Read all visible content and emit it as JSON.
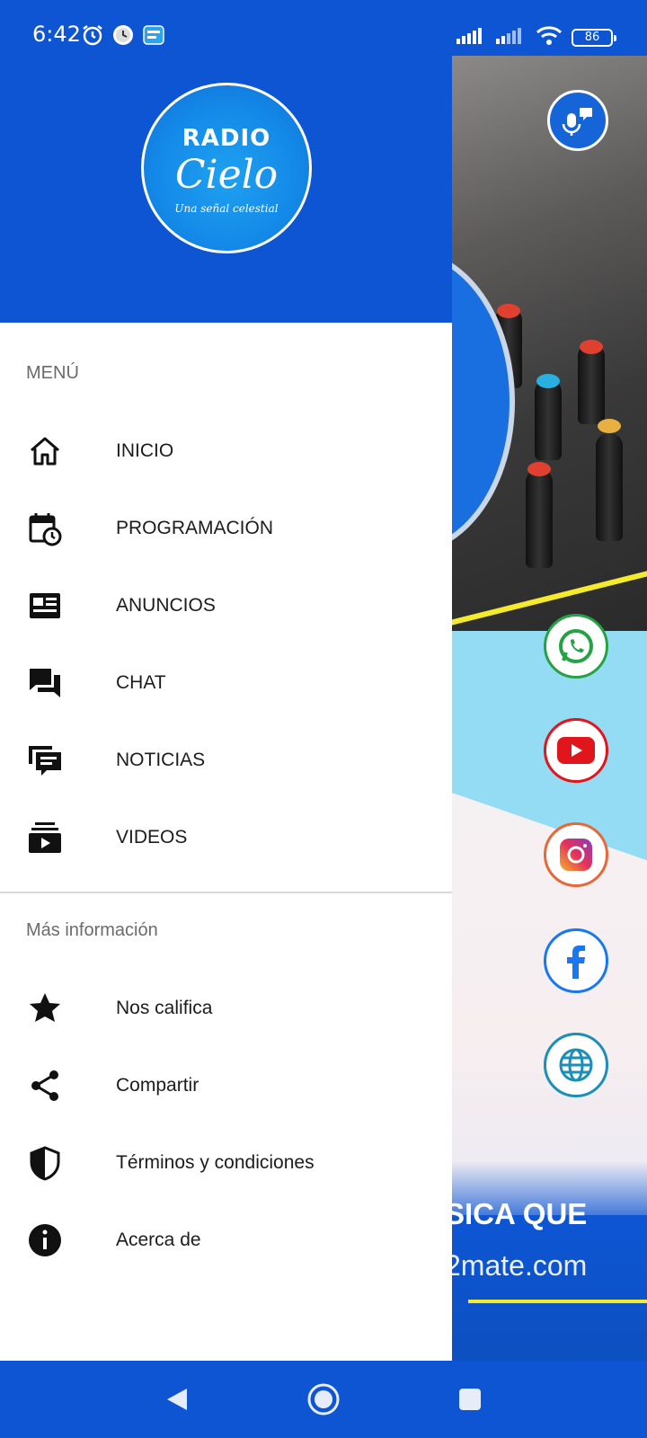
{
  "status": {
    "time": "6:42",
    "battery": "86"
  },
  "logo": {
    "line1": "RADIO",
    "line2": "Cielo",
    "tagline": "Una señal celestial"
  },
  "menu": {
    "section_title": "MENÚ",
    "items": [
      {
        "label": "INICIO",
        "icon": "home-icon"
      },
      {
        "label": "PROGRAMACIÓN",
        "icon": "calendar-clock-icon"
      },
      {
        "label": "ANUNCIOS",
        "icon": "newspaper-icon"
      },
      {
        "label": "CHAT",
        "icon": "chat-icon"
      },
      {
        "label": "NOTICIAS",
        "icon": "news-feed-icon"
      },
      {
        "label": "VIDEOS",
        "icon": "video-library-icon"
      }
    ]
  },
  "more": {
    "section_title": "Más información",
    "items": [
      {
        "label": "Nos califica",
        "icon": "star-icon"
      },
      {
        "label": "Compartir",
        "icon": "share-icon"
      },
      {
        "label": "Términos y condiciones",
        "icon": "shield-icon"
      },
      {
        "label": "Acerca de",
        "icon": "info-icon"
      }
    ]
  },
  "background": {
    "banner_text": "SICA QUE",
    "banner_site": "2mate.com"
  },
  "colors": {
    "brand_blue": "#0d55d2",
    "whatsapp": "#25a244",
    "youtube": "#e0161c",
    "facebook": "#1877f2",
    "web": "#1a8fb8",
    "accent_yellow": "#f5ea2c"
  }
}
